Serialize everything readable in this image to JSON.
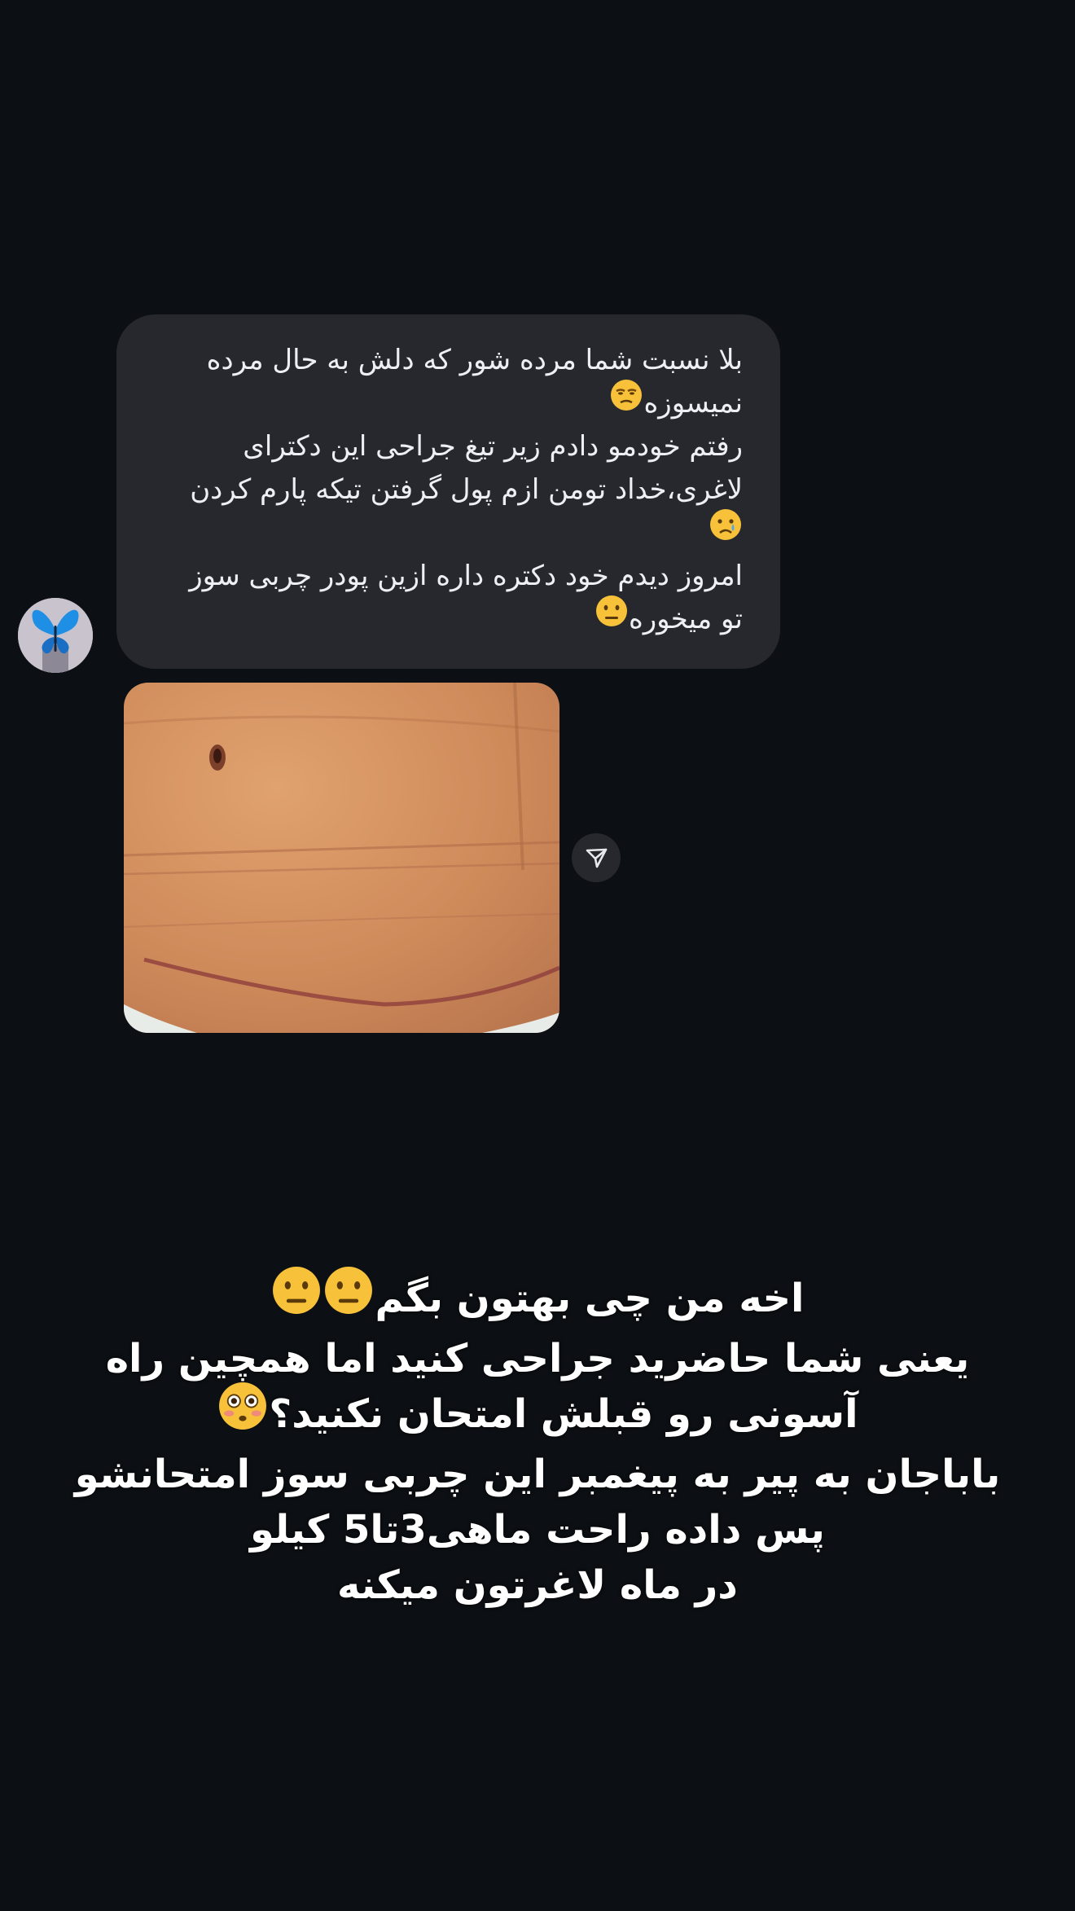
{
  "message": {
    "lines": [
      "بلا نسبت شما مرده شور که دلش به حال مرده",
      "نمیسوزه",
      "رفتم خودمو دادم زیر تیغ جراحی این دکترای",
      "لاغری،خداد تومن ازم پول گرفتن تیکه پارم کردن",
      "",
      "امروز دیدم خود دکتره داره ازین پودر چربی سوز",
      "تو میخوره"
    ],
    "emojis": {
      "unamused": "😒",
      "crying": "😢",
      "neutral": "😐"
    }
  },
  "share_icon": "send-icon",
  "avatar_icon": "butterfly-icon",
  "caption": {
    "lines": [
      "اخه من چی بهتون بگم",
      "یعنی شما حاضرید جراحی کنید اما همچین راه",
      "آسونی رو قبلش امتحان نکنید؟",
      "باباجان به پیر به پیغمبر این چربی سوز امتحانشو",
      "پس داده راحت ماهی3تا5 کیلو",
      "در ماه  لاغرتون میکنه"
    ]
  },
  "colors": {
    "background": "#0c0f13",
    "bubble": "#26282d",
    "text": "#eceff3"
  }
}
